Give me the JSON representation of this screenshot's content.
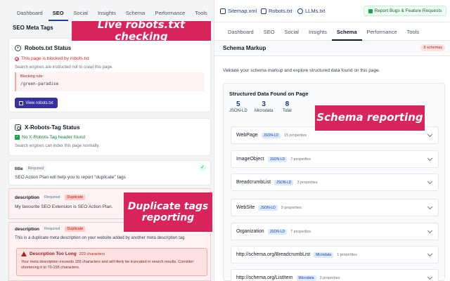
{
  "left": {
    "tabs": [
      "Dashboard",
      "SEO",
      "Social",
      "Insights",
      "Schema",
      "Performance",
      "Tools"
    ],
    "active_tab": "SEO",
    "section_title": "SEO Meta Tags",
    "robots": {
      "title": "Robots.txt Status",
      "status": "This page is blocked by robots.txt",
      "desc": "Search engines are instructed not to crawl this page.",
      "blocking_label": "Blocking rule:",
      "blocking_value": "/green-paradise",
      "button": "View robots.txt"
    },
    "xrobots": {
      "title": "X-Robots-Tag Status",
      "status": "No X-Robots-Tag header found",
      "desc": "Search engines can index this page normally."
    },
    "title_field": {
      "label": "title",
      "required": "Required",
      "value": "SEO Action Plan will help you to report \"duplicate\" tags"
    },
    "desc1": {
      "label": "description",
      "required": "Required",
      "duplicate": "Duplicate",
      "value": "My favourite SEO Extension is SEO Action Plan."
    },
    "desc2": {
      "label": "description",
      "required": "Required",
      "duplicate": "Duplicate",
      "value": "This is a duplicate meta description on your website added by another meta description tag",
      "warning_title": "Description Too Long",
      "warning_count": "223 characters",
      "warning_text": "Your meta description exceeds 155 characters and will likely be truncated in search results. Consider shortening it to 70-155 characters."
    }
  },
  "right": {
    "top_links": [
      "Sitemap.xml",
      "Robots.txt",
      "LLMs.txt"
    ],
    "report_button": "Report Bugs & Feature Requests",
    "tabs": [
      "Dashboard",
      "SEO",
      "Social",
      "Insights",
      "Schema",
      "Performance",
      "Tools"
    ],
    "active_tab": "Schema",
    "section_title": "Schema Markup",
    "badge": "8 schemas",
    "desc": "Validate your schema markup and explore structured data found on this page.",
    "structured": {
      "title": "Structured Data Found on Page",
      "stats": [
        {
          "n": "5",
          "l": "JSON-LD"
        },
        {
          "n": "3",
          "l": "Microdata"
        },
        {
          "n": "8",
          "l": "Total"
        }
      ],
      "rows": [
        {
          "name": "WebPage",
          "tag": "JSON-LD",
          "props": "15 properties"
        },
        {
          "name": "ImageObject",
          "tag": "JSON-LD",
          "props": "7 properties"
        },
        {
          "name": "BreadcrumbList",
          "tag": "JSON-LD",
          "props": "3 properties"
        },
        {
          "name": "WebSite",
          "tag": "JSON-LD",
          "props": "9 properties"
        },
        {
          "name": "Organization",
          "tag": "JSON-LD",
          "props": "7 properties"
        },
        {
          "name": "http://schema.org/BreadcrumbList",
          "tag": "Microdata",
          "props": "1 properties"
        },
        {
          "name": "http://schema.org/ListItem",
          "tag": "Microdata",
          "props": "3 properties"
        }
      ]
    }
  },
  "callouts": {
    "robots": "Live robots.txt checking",
    "schema": "Schema reporting",
    "duplicate": "Duplicate tags reporting"
  }
}
